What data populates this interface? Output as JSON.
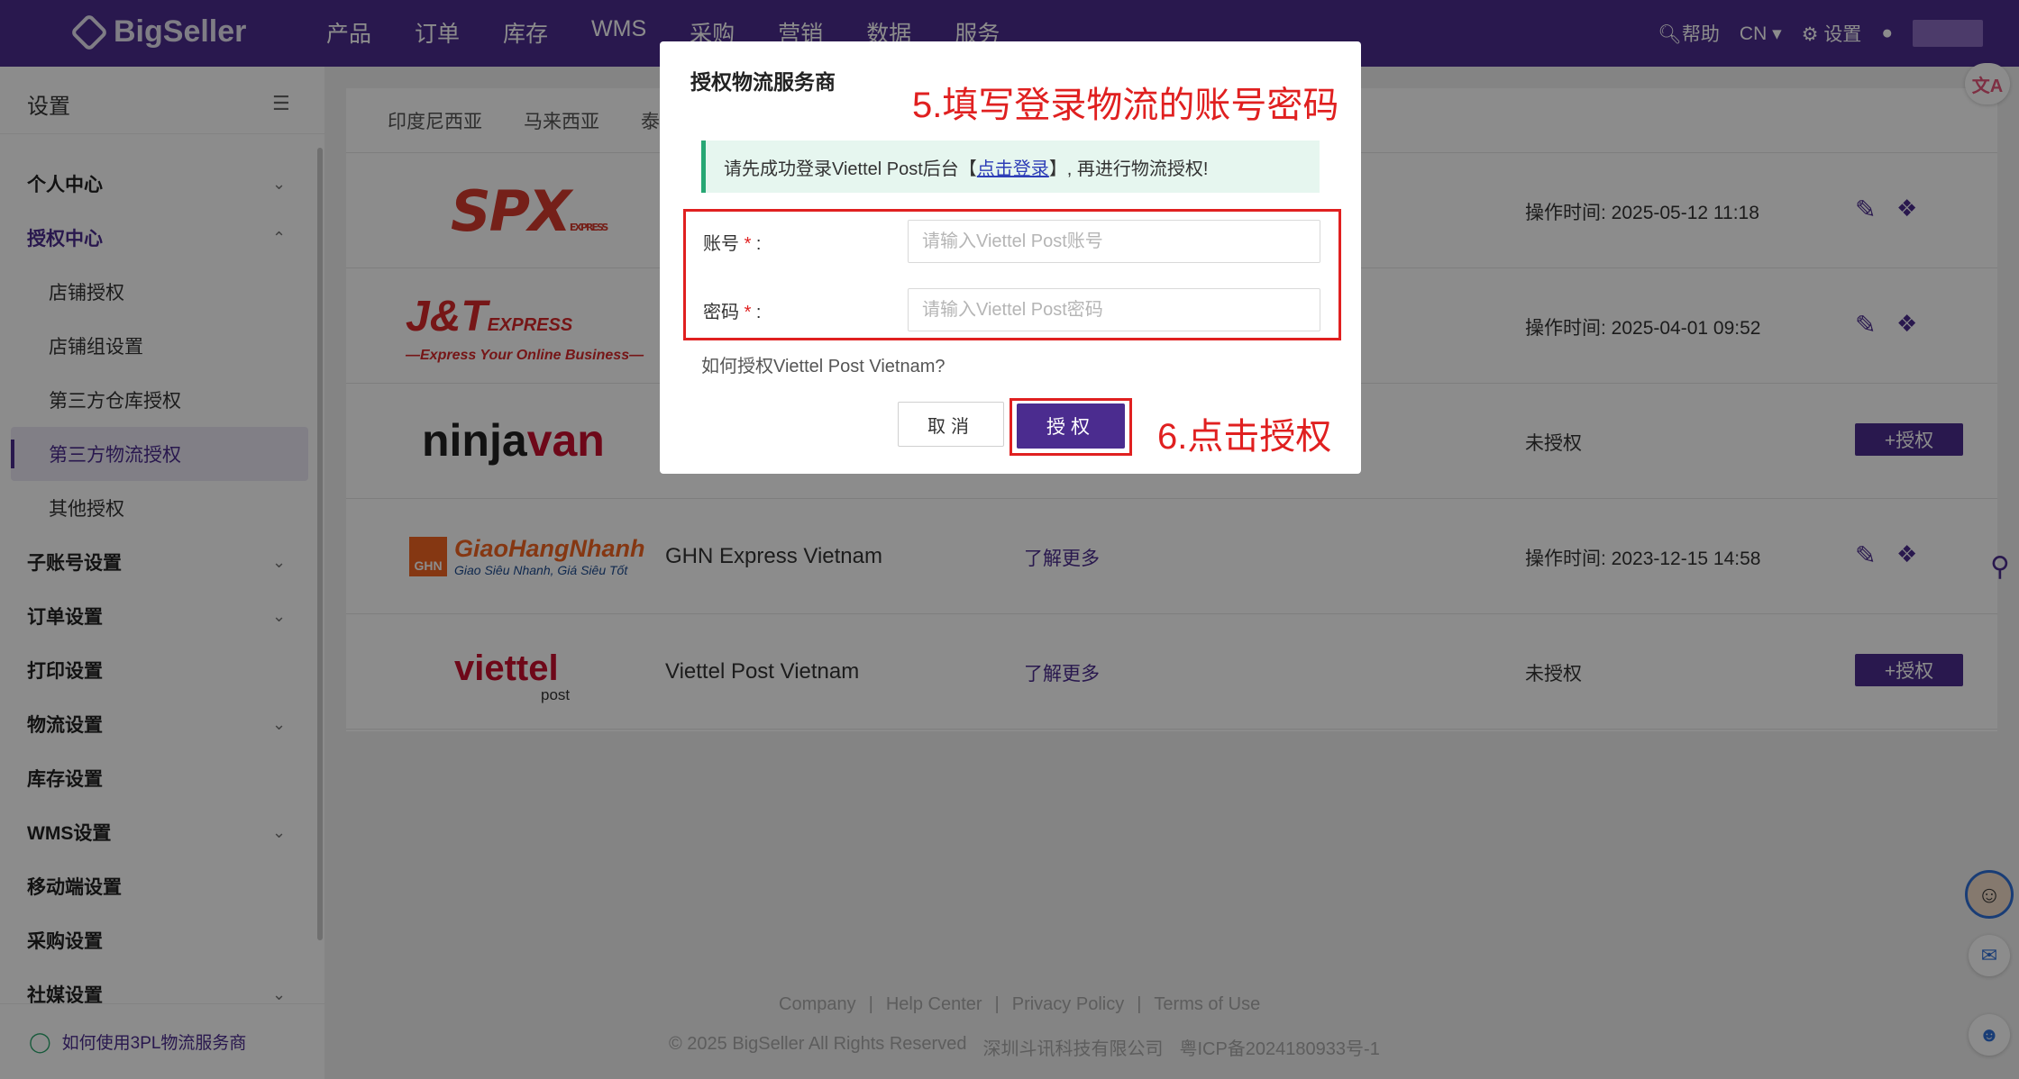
{
  "header": {
    "logo_text": "BigSeller",
    "nav": [
      "产品",
      "订单",
      "库存",
      "WMS",
      "采购",
      "营销",
      "数据",
      "服务"
    ],
    "help_label": "帮助",
    "lang_label": "CN",
    "settings_label": "设置",
    "brand_color": "#4b2c8f"
  },
  "sidebar": {
    "title": "设置",
    "items": [
      {
        "label": "个人中心",
        "chevron": "down"
      },
      {
        "label": "授权中心",
        "chevron": "up"
      },
      {
        "label": "店铺授权"
      },
      {
        "label": "店铺组设置"
      },
      {
        "label": "第三方仓库授权"
      },
      {
        "label": "第三方物流授权"
      },
      {
        "label": "其他授权"
      },
      {
        "label": "子账号设置",
        "chevron": "down"
      },
      {
        "label": "订单设置",
        "chevron": "down"
      },
      {
        "label": "打印设置"
      },
      {
        "label": "物流设置",
        "chevron": "down"
      },
      {
        "label": "库存设置"
      },
      {
        "label": "WMS设置",
        "chevron": "down"
      },
      {
        "label": "移动端设置"
      },
      {
        "label": "采购设置"
      },
      {
        "label": "社媒设置",
        "chevron": "down"
      }
    ],
    "footer_link": "如何使用3PL物流服务商"
  },
  "tabs": [
    "印度尼西亚",
    "马来西亚",
    "泰"
  ],
  "providers": [
    {
      "logo": "SPX",
      "logo_sub": "EXPRESS",
      "status": "操作时间:  2025-05-12 11:18"
    },
    {
      "logo": "J&T",
      "logo_sub": "EXPRESS",
      "tagline": "—Express Your Online Business—",
      "status": "操作时间:  2025-04-01 09:52"
    },
    {
      "logo_a": "ninja",
      "logo_b": "van",
      "status": "未授权",
      "button": "+授权"
    },
    {
      "logo": "GiaoHangNhanh",
      "logo_box": "GHN",
      "logo_sub": "Giao Siêu Nhanh, Giá Siêu Tốt",
      "name": "GHN Express Vietnam",
      "more": "了解更多",
      "status": "操作时间:  2023-12-15 14:58"
    },
    {
      "logo": "viettel",
      "logo_sub": "post",
      "name": "Viettel Post Vietnam",
      "more": "了解更多",
      "status": "未授权",
      "button": "+授权"
    }
  ],
  "footer": {
    "links": [
      "Company",
      "|",
      "Help Center",
      "|",
      "Privacy Policy",
      "|",
      "Terms of Use"
    ],
    "copyright": "© 2025 BigSeller All Rights Reserved",
    "company": "深圳斗讯科技有限公司",
    "icp": "粤ICP备2024180933号-1"
  },
  "modal": {
    "title": "授权物流服务商",
    "annotation_step5": "5.填写登录物流的账号密码",
    "notice_prefix": "请先成功登录Viettel Post后台【",
    "notice_link": "点击登录",
    "notice_suffix": "】, 再进行物流授权!",
    "account_label": "账号",
    "password_label": "密码",
    "required_mark": "*",
    "colon": ":",
    "account_placeholder": "请输入Viettel Post账号",
    "password_placeholder": "请输入Viettel Post密码",
    "help_link": "如何授权Viettel Post Vietnam?",
    "cancel_label": "取消",
    "confirm_label": "授权",
    "annotation_step6": "6.点击授权",
    "annotation_color": "#e02020"
  }
}
